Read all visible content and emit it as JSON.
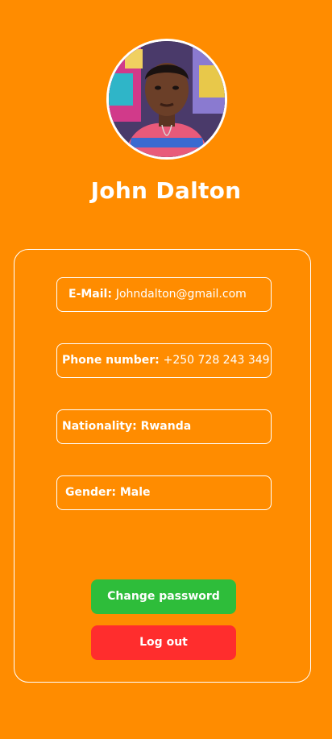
{
  "profile": {
    "name": "John Dalton"
  },
  "fields": {
    "email": {
      "label": "E-Mail:",
      "value": "Johndalton@gmail.com"
    },
    "phone": {
      "label": "Phone number:",
      "value": "+250 728 243 349"
    },
    "nationality": {
      "label": "Nationality:",
      "value": "Rwanda"
    },
    "gender": {
      "label": "Gender:",
      "value": "Male"
    }
  },
  "actions": {
    "change_password_label": "Change password",
    "logout_label": "Log out"
  },
  "colors": {
    "background": "#FF8C00",
    "change_password": "#2EBD3A",
    "logout": "#FF2D2D"
  },
  "icons": {
    "avatar": "profile-photo"
  }
}
